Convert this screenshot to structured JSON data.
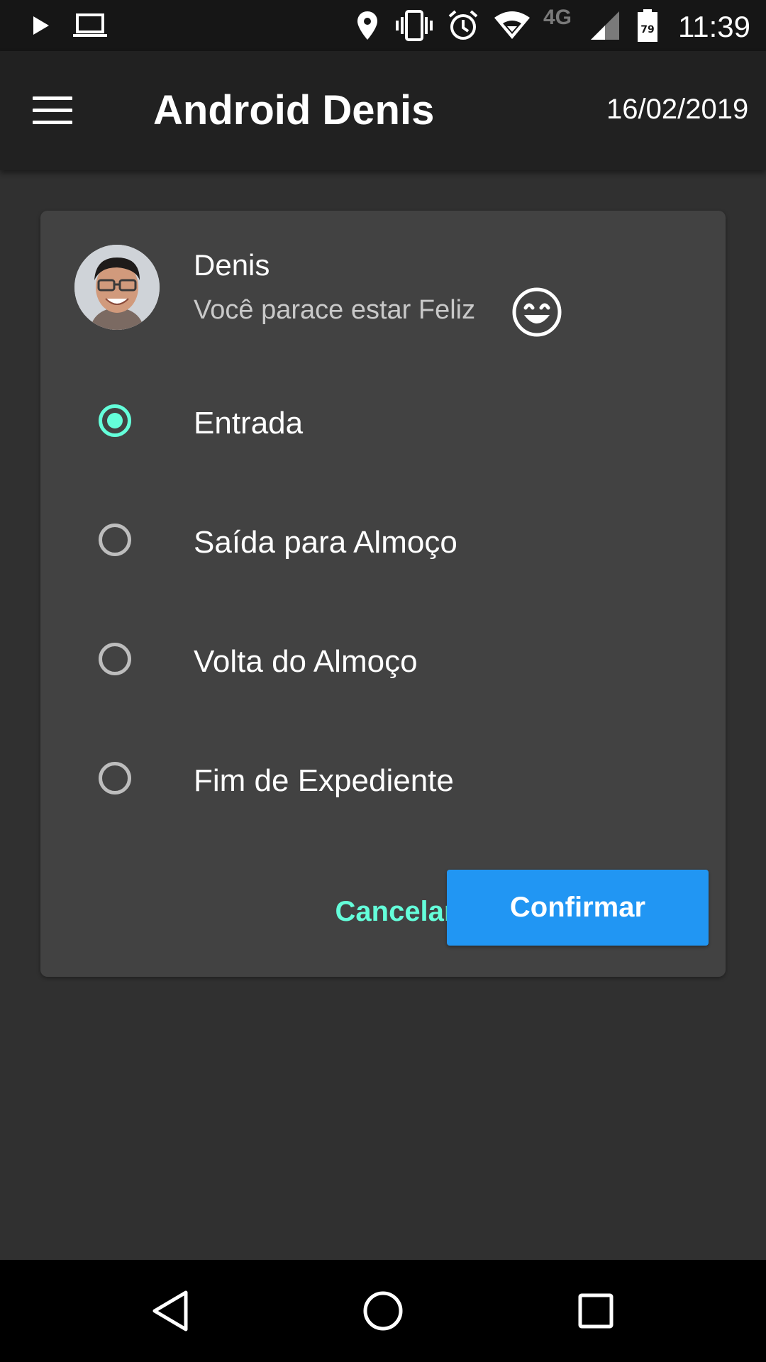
{
  "status_bar": {
    "time": "11:39",
    "network": "4G",
    "battery_level": "79",
    "icons": [
      "play-icon",
      "laptop-icon",
      "location-icon",
      "vibrate-icon",
      "alarm-icon",
      "wifi-icon",
      "signal-icon",
      "battery-icon"
    ]
  },
  "app_bar": {
    "title": "Android Denis",
    "date": "16/02/2019",
    "menu_icon": "menu-icon"
  },
  "card": {
    "user": {
      "name": "Denis",
      "status_text": "Você parace estar Feliz",
      "mood_icon": "smile-icon"
    },
    "options": [
      {
        "label": "Entrada",
        "checked": true
      },
      {
        "label": "Saída para Almoço",
        "checked": false
      },
      {
        "label": "Volta do Almoço",
        "checked": false
      },
      {
        "label": "Fim de Expediente",
        "checked": false
      }
    ],
    "cancel_label": "Cancelar",
    "confirm_label": "Confirmar"
  },
  "nav_bar": {
    "icons": [
      "back-icon",
      "home-icon",
      "recents-icon"
    ]
  },
  "colors": {
    "background": "#303030",
    "app_bar": "#212121",
    "card": "#424242",
    "accent": "#64ffda",
    "primary_button": "#2196f3"
  }
}
